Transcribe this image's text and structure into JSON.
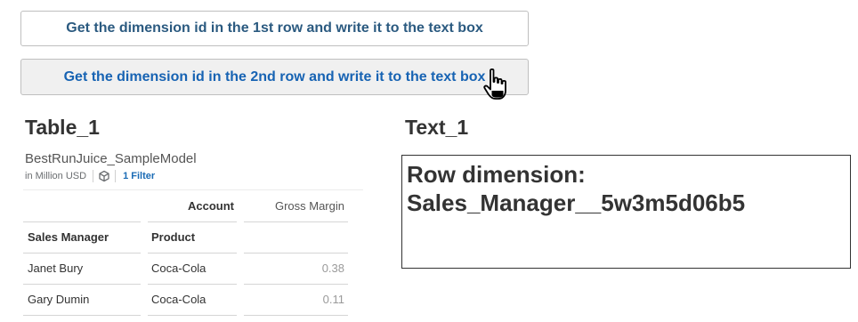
{
  "buttons": {
    "first_row_label": "Get the dimension id in the 1st row and write it to the text box",
    "second_row_label": "Get the dimension id in the 2nd row and write it to the text box"
  },
  "table_widget": {
    "title": "Table_1",
    "model_name": "BestRunJuice_SampleModel",
    "unit": "in Million USD",
    "filter_label": "1 Filter",
    "column_headers": {
      "account": "Account",
      "gross_margin": "Gross Margin"
    },
    "row_headers": {
      "sales_manager": "Sales Manager",
      "product": "Product"
    },
    "rows": [
      {
        "sales_manager": "Janet Bury",
        "product": "Coca-Cola",
        "gross_margin": "0.38"
      },
      {
        "sales_manager": "Gary Dumin",
        "product": "Coca-Cola",
        "gross_margin": "0.11"
      }
    ]
  },
  "text_widget": {
    "title": "Text_1",
    "line1": "Row dimension:",
    "line2": "Sales_Manager__5w3m5d06b5"
  },
  "icons": {
    "cube": "cube-icon",
    "cursor": "hand-pointer-icon"
  }
}
